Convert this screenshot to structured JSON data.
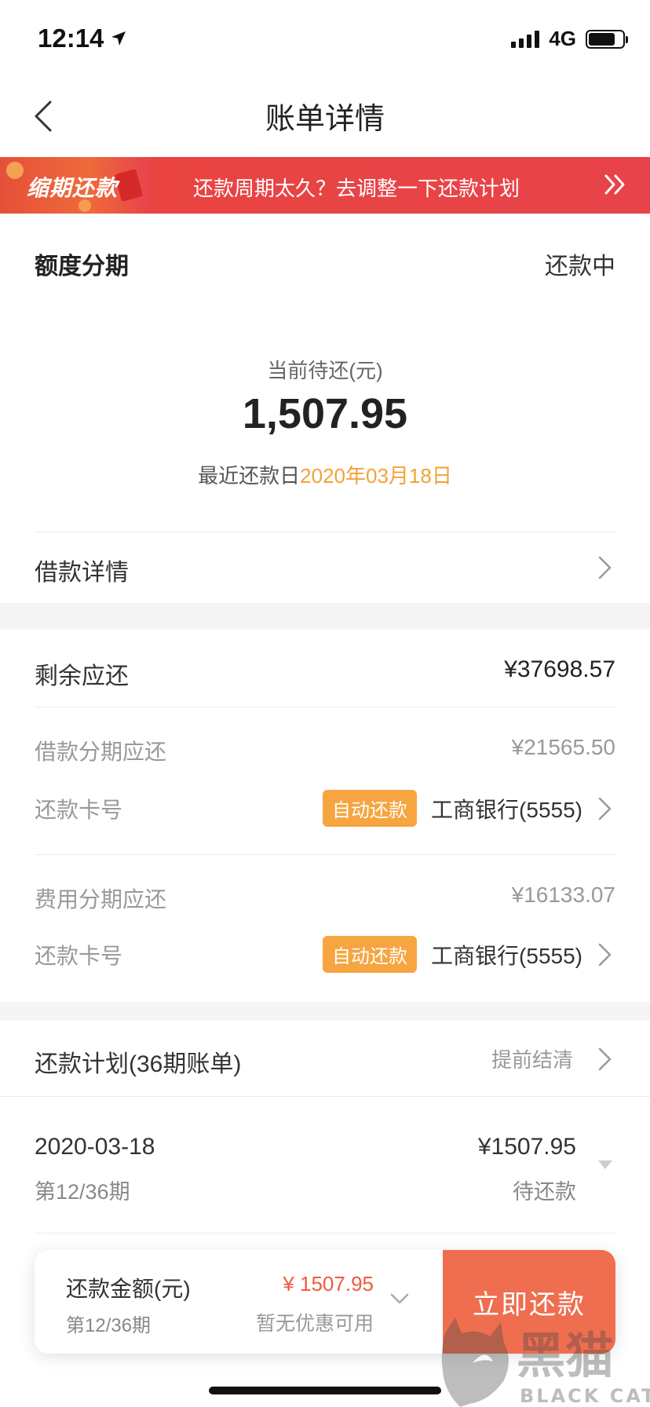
{
  "status_bar": {
    "time": "12:14",
    "network": "4G"
  },
  "nav": {
    "title": "账单详情"
  },
  "banner": {
    "tag": "缩期还款",
    "text": "还款周期太久？去调整一下还款计划"
  },
  "summary": {
    "product": "额度分期",
    "status": "还款中",
    "due_label": "当前待还(元)",
    "due_amount": "1,507.95",
    "due_date_label": "最近还款日",
    "due_date": "2020年03月18日"
  },
  "loan_details": {
    "label": "借款详情"
  },
  "remaining": {
    "label": "剩余应还",
    "value": "¥37698.57"
  },
  "loan_installment": {
    "label": "借款分期应还",
    "value": "¥21565.50",
    "card_label": "还款卡号",
    "badge": "自动还款",
    "card": "工商银行(5555)"
  },
  "fee_installment": {
    "label": "费用分期应还",
    "value": "¥16133.07",
    "card_label": "还款卡号",
    "badge": "自动还款",
    "card": "工商银行(5555)"
  },
  "plan": {
    "label": "还款计划(36期账单)",
    "action": "提前结清"
  },
  "bill": {
    "date": "2020-03-18",
    "period": "第12/36期",
    "amount": "¥1507.95",
    "status": "待还款"
  },
  "pay_bar": {
    "label": "还款金额(元)",
    "period": "第12/36期",
    "amount": "¥ 1507.95",
    "discount": "暂无优惠可用",
    "button": "立即还款"
  },
  "watermark": {
    "brand": "黑猫",
    "brand_en": "BLACK CAT"
  },
  "colors": {
    "banner_red": "#e8434a",
    "accent_orange": "#f2a237",
    "badge_orange": "#f6a540",
    "pay_button": "#ef6e50",
    "pay_amount": "#f05a3f"
  },
  "icons": [
    "location-arrow-icon",
    "signal-icon",
    "battery-icon",
    "back-icon",
    "double-chevron-right-icon",
    "chevron-right-icon",
    "caret-down-icon",
    "chevron-down-icon"
  ]
}
